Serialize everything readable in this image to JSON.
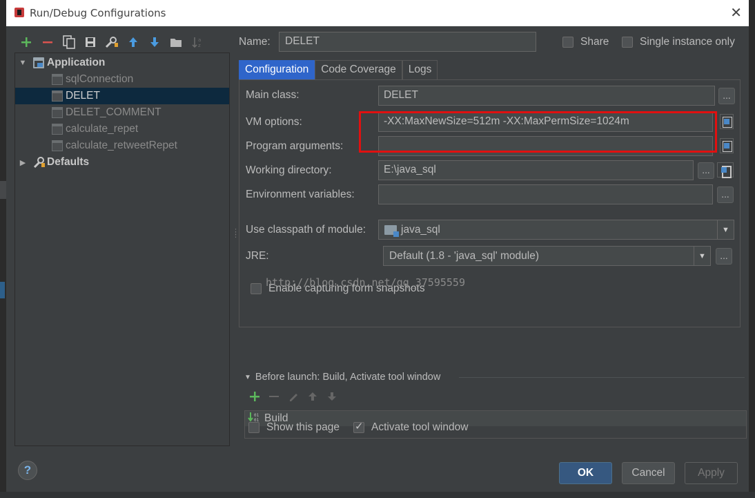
{
  "window": {
    "title": "Run/Debug Configurations"
  },
  "toolbar": {
    "icons": [
      "add-icon",
      "remove-icon",
      "copy-icon",
      "save-icon",
      "edit-defaults-icon",
      "move-up-icon",
      "move-down-icon",
      "folder-icon",
      "sort-icon"
    ]
  },
  "tree": {
    "application_label": "Application",
    "items": [
      "sqlConnection",
      "DELET",
      "DELET_COMMENT",
      "calculate_repet",
      "calculate_retweetRepet"
    ],
    "selected": "DELET",
    "defaults_label": "Defaults"
  },
  "header": {
    "name_label": "Name:",
    "name_value": "DELET",
    "share_label": "Share",
    "single_instance_label": "Single instance only"
  },
  "tabs": [
    "Configuration",
    "Code Coverage",
    "Logs"
  ],
  "config": {
    "main_class_label": "Main class:",
    "main_class_value": "DELET",
    "vm_options_label": "VM options:",
    "vm_options_value": "-XX:MaxNewSize=512m -XX:MaxPermSize=1024m",
    "program_args_label": "Program arguments:",
    "program_args_value": "",
    "working_dir_label": "Working directory:",
    "working_dir_value": "E:\\java_sql",
    "env_vars_label": "Environment variables:",
    "env_vars_value": "",
    "classpath_label": "Use classpath of module:",
    "classpath_value": "java_sql",
    "jre_label": "JRE:",
    "jre_value": "Default (1.8 - 'java_sql' module)",
    "snapshots_label": "Enable capturing form snapshots",
    "ellipsis": "..."
  },
  "watermark": "http://blog.csdn.net/qq_37595559",
  "before_launch": {
    "header": "Before launch: Build, Activate tool window",
    "items": [
      "Build"
    ]
  },
  "footer": {
    "show_page_label": "Show this page",
    "activate_tool_label": "Activate tool window",
    "ok": "OK",
    "cancel": "Cancel",
    "apply": "Apply",
    "help": "?"
  },
  "colors": {
    "accent": "#2f65ca",
    "highlight_box": "#e01010",
    "selection": "#0d293e",
    "add_green": "#5cb85c",
    "remove_red": "#d9534f"
  }
}
